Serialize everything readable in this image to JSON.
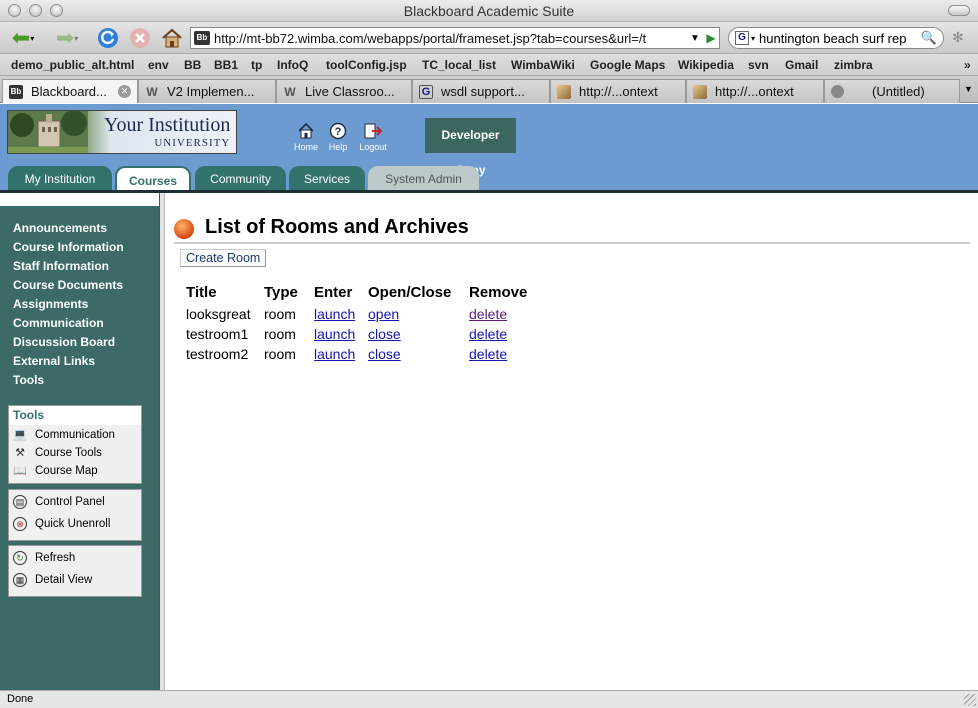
{
  "window": {
    "title": "Blackboard Academic Suite"
  },
  "browser": {
    "url": "http://mt-bb72.wimba.com/webapps/portal/frameset.jsp?tab=courses&url=/t",
    "search": "huntington beach surf rep",
    "bookmarks": [
      "demo_public_alt.html",
      "env",
      "BB",
      "BB1",
      "tp",
      "InfoQ",
      "toolConfig.jsp",
      "TC_local_list",
      "WimbaWiki",
      "Google Maps",
      "Wikipedia",
      "svn",
      "Gmail",
      "zimbra"
    ],
    "tabs": [
      {
        "label": "Blackboard...",
        "icon": "Bb"
      },
      {
        "label": "V2 Implemen...",
        "icon": "W"
      },
      {
        "label": "Live Classroo...",
        "icon": "W"
      },
      {
        "label": "wsdl support...",
        "icon": "G"
      },
      {
        "label": "http://...ontext",
        "icon": "img"
      },
      {
        "label": "http://...ontext",
        "icon": "img"
      },
      {
        "label": "(Untitled)",
        "icon": "o"
      }
    ],
    "status": "Done"
  },
  "header": {
    "logo_main": "Your Institution",
    "logo_sub": "UNIVERSITY",
    "icons": [
      {
        "label": "Home"
      },
      {
        "label": "Help"
      },
      {
        "label": "Logout"
      }
    ],
    "dev_copy": "Developer Copy",
    "tabs": [
      "My Institution",
      "Courses",
      "Community",
      "Services",
      "System Admin"
    ]
  },
  "leftnav": {
    "links": [
      "Announcements",
      "Course Information",
      "Staff Information",
      "Course Documents",
      "Assignments",
      "Communication",
      "Discussion Board",
      "External Links",
      "Tools"
    ],
    "tools_header": "Tools",
    "tools": [
      "Communication",
      "Course Tools",
      "Course Map"
    ],
    "panel": [
      "Control Panel",
      "Quick Unenroll"
    ],
    "view": [
      "Refresh",
      "Detail View"
    ]
  },
  "main": {
    "title": "List of Rooms and Archives",
    "create_button": "Create Room",
    "columns": [
      "Title",
      "Type",
      "Enter",
      "Open/Close",
      "Remove"
    ],
    "rows": [
      {
        "title": "looksgreat",
        "type": "room",
        "enter": "launch",
        "openclose": "open",
        "remove": "delete"
      },
      {
        "title": "testroom1",
        "type": "room",
        "enter": "launch",
        "openclose": "close",
        "remove": "delete"
      },
      {
        "title": "testroom2",
        "type": "room",
        "enter": "launch",
        "openclose": "close",
        "remove": "delete"
      }
    ]
  },
  "colors": {
    "header_blue": "#6b9bd1",
    "nav_teal": "#3b6a67",
    "tab_teal": "#33726c",
    "link_blue": "#1515b0"
  }
}
